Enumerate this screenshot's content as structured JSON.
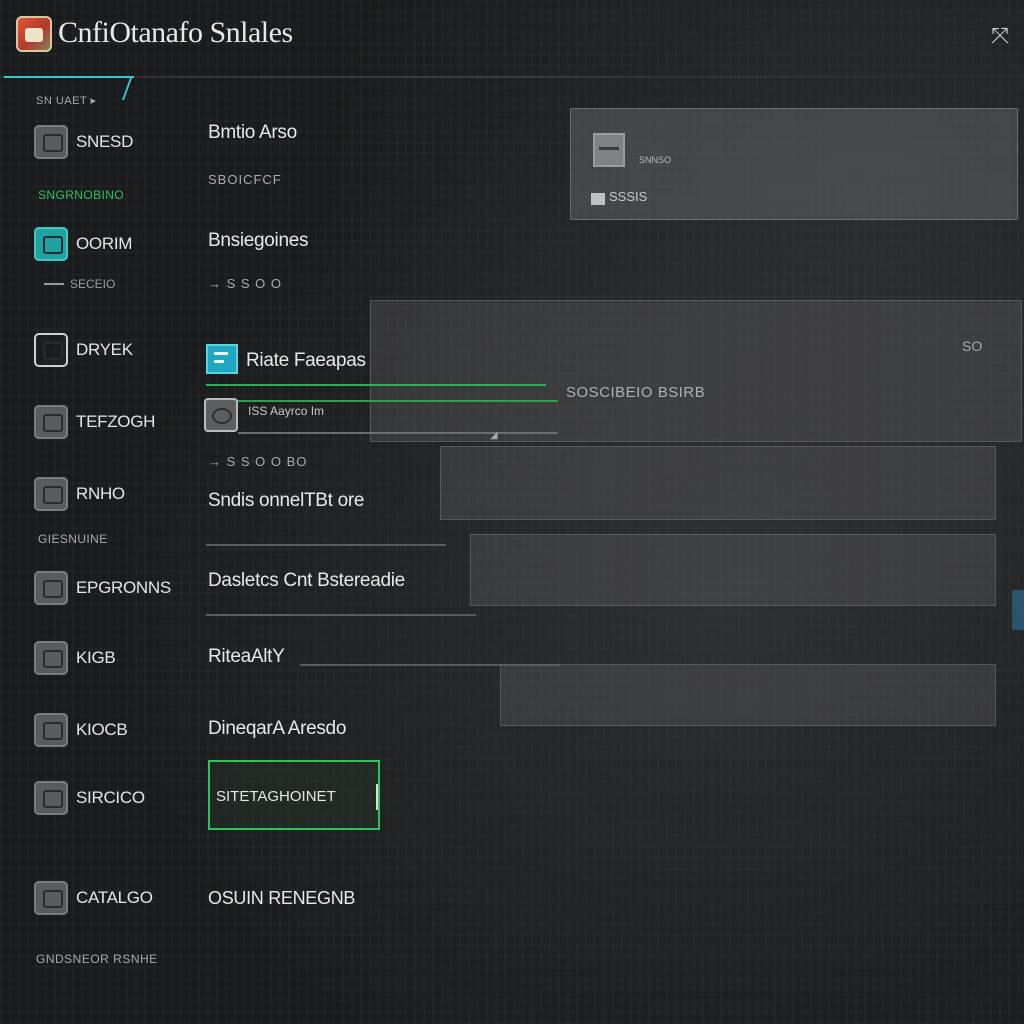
{
  "window": {
    "title": "CnfiOtanafo Snlales",
    "close_glyph": "⤧"
  },
  "sidebar": {
    "header": "SN UAET ▸",
    "section_1": "SNGRNOBINO",
    "section_2": "GIESNUINE",
    "items": [
      {
        "label": "SNESD",
        "icon": "document-icon"
      },
      {
        "label": "OORIM",
        "icon": "teal-app-icon",
        "sub": "SECEIO"
      },
      {
        "label": "DRYEK",
        "icon": "folder-icon"
      },
      {
        "label": "TEFZOGH",
        "icon": "grid-icon"
      },
      {
        "label": "RNHO",
        "icon": "box-icon"
      },
      {
        "label": "EPGRONNS",
        "icon": "gear-icon"
      },
      {
        "label": "KIGB",
        "icon": "tag-icon"
      },
      {
        "label": "KIOCB",
        "icon": "square-icon"
      },
      {
        "label": "SIRCICO",
        "icon": "list-icon"
      },
      {
        "label": "CATALGO",
        "icon": "catalog-icon"
      }
    ],
    "footer": "GNDSNEOR RSNHE"
  },
  "main": {
    "rows": [
      {
        "title": "Bmtio Arso",
        "sub": "SBOICFCF"
      },
      {
        "title": "Bnsiegoines",
        "sub": "→ S S O O"
      },
      {
        "title": "Riate Faeapas",
        "sub": "ISS Aayrco Im"
      },
      {
        "title": "Sndis onnelTBt ore",
        "sub": "→ S S O O BO"
      },
      {
        "title": "Dasletcs Cnt Bstereadie",
        "sub": ""
      },
      {
        "title": "RiteaAltY",
        "sub": ""
      },
      {
        "title": "DineqarA Aresdo",
        "sub": ""
      },
      {
        "title": "OSUIN RENEGNB",
        "sub": ""
      }
    ],
    "info_text": "SOSCIBEIO BSIRB",
    "search": {
      "value": "SITETAGHOINET"
    },
    "corner_badge": "SO"
  },
  "card": {
    "sub": "SNNSO",
    "chip": "SSSIS"
  },
  "colors": {
    "accent_cyan": "#39c6d1",
    "accent_green": "#2fc15a",
    "background": "#1b1c1d"
  }
}
